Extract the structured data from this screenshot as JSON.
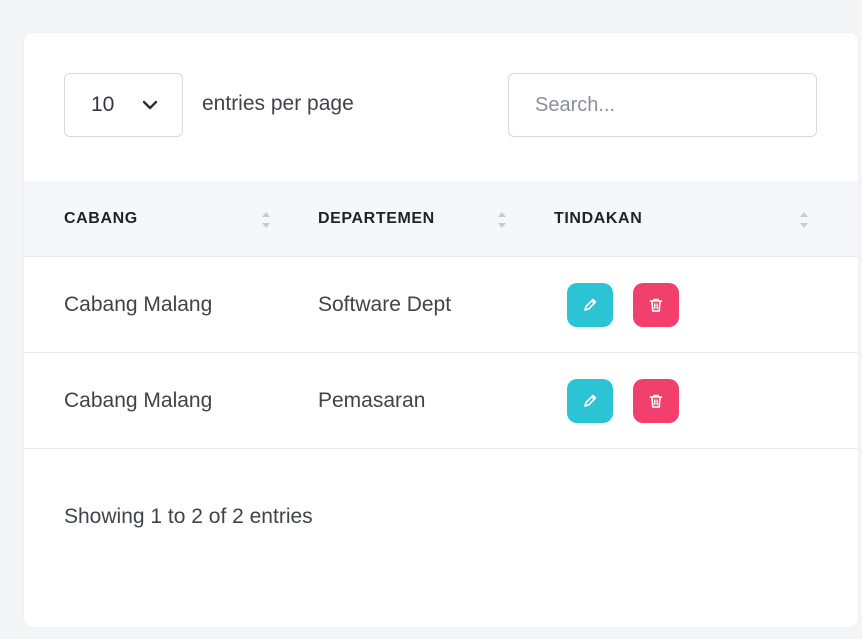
{
  "toolbar": {
    "page_size": "10",
    "entries_label": "entries per page",
    "search_placeholder": "Search..."
  },
  "table": {
    "columns": [
      "CABANG",
      "DEPARTEMEN",
      "TINDAKAN"
    ],
    "rows": [
      {
        "cabang": "Cabang Malang",
        "departemen": "Software Dept"
      },
      {
        "cabang": "Cabang Malang",
        "departemen": "Pemasaran"
      }
    ]
  },
  "footer": {
    "info": "Showing 1 to 2 of 2 entries"
  },
  "icons": {
    "edit": "pencil-icon",
    "delete": "trash-icon",
    "select": "chevron-down-icon",
    "sort": "sort-icon"
  },
  "colors": {
    "edit_button": "#2cc3d5",
    "delete_button": "#f1406c",
    "header_bg": "#f5f7fb"
  }
}
